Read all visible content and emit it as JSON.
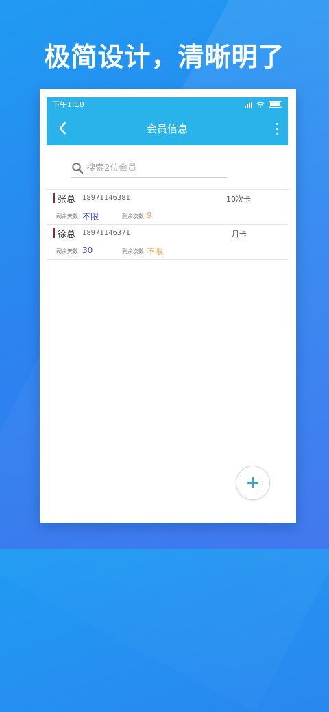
{
  "slogan": "极简设计，清晰明了",
  "status_bar": {
    "time": "下午1:18"
  },
  "app_bar": {
    "title": "会员信息"
  },
  "search": {
    "placeholder": "搜索2位会员"
  },
  "members": [
    {
      "name": "张总",
      "phone": "18971146381",
      "card": "10次卡",
      "days_label": "剩余天数",
      "days_value": "不限",
      "times_label": "剩余次数",
      "times_value": "9"
    },
    {
      "name": "徐总",
      "phone": "18971146371",
      "card": "月卡",
      "days_label": "剩余天数",
      "days_value": "30",
      "times_label": "剩余次数",
      "times_value": "不限"
    }
  ],
  "colors": {
    "app_bar": "#29b3ea",
    "accent_blue": "#2b3fd6",
    "accent_orange": "#f0a050"
  },
  "icons": [
    "back-arrow-icon",
    "more-vert-icon",
    "search-icon",
    "plus-icon",
    "signal-icon",
    "wifi-icon",
    "battery-icon"
  ]
}
